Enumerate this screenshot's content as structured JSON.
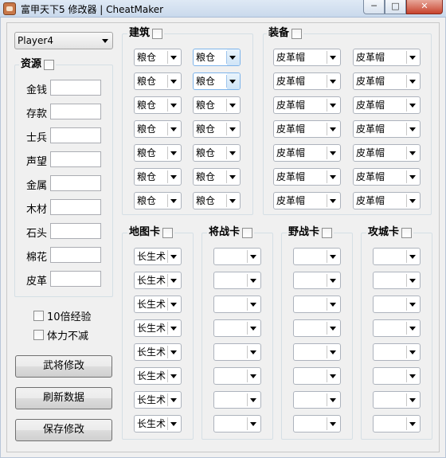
{
  "window": {
    "title": "富甲天下5 修改器 | CheatMaker",
    "min_glyph": "─",
    "max_glyph": "□",
    "close_glyph": "✕"
  },
  "player_select": {
    "value": "Player4"
  },
  "resources": {
    "label": "资源",
    "fields": [
      "金钱",
      "存款",
      "士兵",
      "声望",
      "金属",
      "木材",
      "石头",
      "棉花",
      "皮革"
    ]
  },
  "options": {
    "exp10": "10倍经验",
    "stamina": "体力不减"
  },
  "buttons": {
    "general": "武将修改",
    "refresh": "刷新数据",
    "save": "保存修改"
  },
  "building": {
    "label": "建筑",
    "rows": [
      [
        "粮仓",
        "粮仓"
      ],
      [
        "粮仓",
        "粮仓"
      ],
      [
        "粮仓",
        "粮仓"
      ],
      [
        "粮仓",
        "粮仓"
      ],
      [
        "粮仓",
        "粮仓"
      ],
      [
        "粮仓",
        "粮仓"
      ],
      [
        "粮仓",
        "粮仓"
      ]
    ]
  },
  "equipment": {
    "label": "装备",
    "rows": [
      [
        "皮革帽",
        "皮革帽"
      ],
      [
        "皮革帽",
        "皮革帽"
      ],
      [
        "皮革帽",
        "皮革帽"
      ],
      [
        "皮革帽",
        "皮革帽"
      ],
      [
        "皮革帽",
        "皮革帽"
      ],
      [
        "皮革帽",
        "皮革帽"
      ],
      [
        "皮革帽",
        "皮革帽"
      ]
    ]
  },
  "map_cards": {
    "label": "地图卡",
    "values": [
      "长生术",
      "长生术",
      "长生术",
      "长生术",
      "长生术",
      "长生术",
      "长生术",
      "长生术"
    ]
  },
  "general_cards": {
    "label": "将战卡",
    "values": [
      "",
      "",
      "",
      "",
      "",
      "",
      "",
      ""
    ]
  },
  "field_cards": {
    "label": "野战卡",
    "values": [
      "",
      "",
      "",
      "",
      "",
      "",
      "",
      ""
    ]
  },
  "siege_cards": {
    "label": "攻城卡",
    "values": [
      "",
      "",
      "",
      "",
      "",
      "",
      "",
      ""
    ]
  }
}
